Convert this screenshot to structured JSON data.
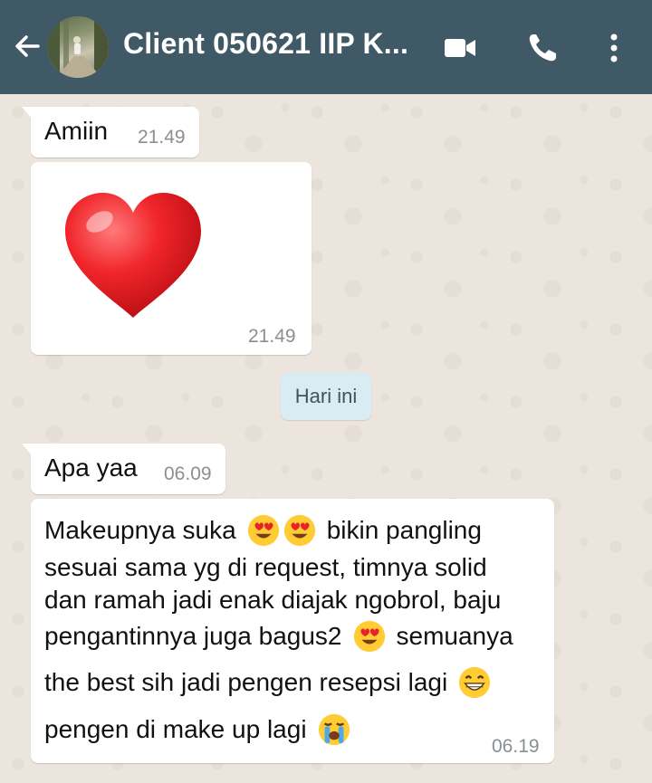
{
  "header": {
    "title": "Client 050621 IIP K...",
    "background": "#3f5a66"
  },
  "icons": [
    "back-arrow-icon",
    "video-call-icon",
    "phone-icon",
    "more-vert-icon"
  ],
  "messages": [
    {
      "text": "Amiin",
      "time": "21.49"
    },
    {
      "sticker": "red-heart",
      "time": "21.49"
    },
    {
      "text": "Apa yaa",
      "time": "06.09"
    },
    {
      "lines": [
        {
          "a": "Makeupnya suka",
          "b": "bikin pangling"
        },
        {
          "a": "sesuai sama yg di request, timnya solid"
        },
        {
          "a": "dan ramah jadi enak diajak ngobrol, baju"
        },
        {
          "a": "pengantinnya juga bagus2",
          "b": "semuanya"
        },
        {
          "a": "the best sih jadi pengen resepsi lagi"
        },
        {
          "a": "pengen di make up lagi"
        }
      ],
      "time": "06.19"
    }
  ],
  "date_divider": "Hari ini",
  "colors": {
    "bubble": "#ffffff",
    "date_chip": "#d9ecf3",
    "wallpaper": "#ece5dd"
  }
}
